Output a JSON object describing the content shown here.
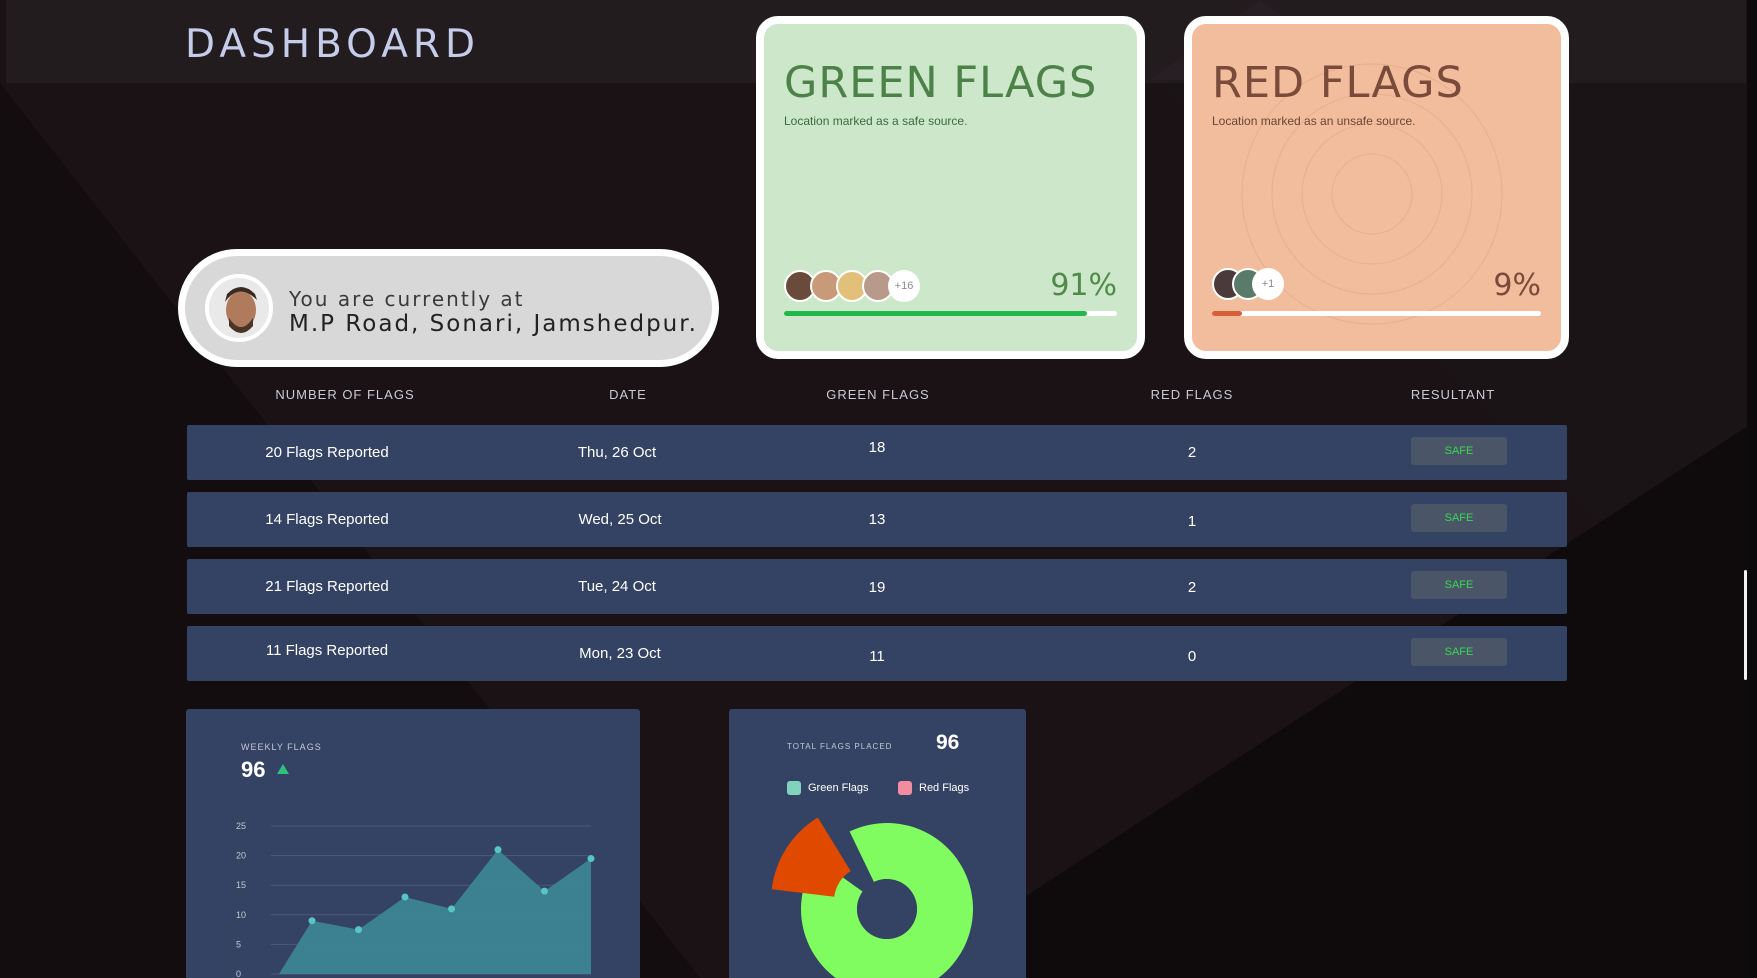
{
  "header": {
    "title": "DASHBOARD"
  },
  "location": {
    "line1": "You are currently at",
    "line2": "M.P Road, Sonari, Jamshedpur."
  },
  "green_card": {
    "title": "GREEN FLAGS",
    "subtitle": "Location marked as a safe source.",
    "percent_label": "91%",
    "percent_value": 0.91,
    "more_label": "+16",
    "color": "#20b84a"
  },
  "red_card": {
    "title": "RED FLAGS",
    "subtitle": "Location marked as an unsafe source.",
    "percent_label": "9%",
    "percent_value": 0.09,
    "more_label": "+1",
    "color": "#d4603a"
  },
  "table": {
    "headers": [
      "NUMBER OF FLAGS",
      "DATE",
      "GREEN FLAGS",
      "RED FLAGS",
      "RESULTANT"
    ],
    "rows": [
      {
        "flags": "20 Flags Reported",
        "date": "Thu, 26 Oct",
        "green": "18",
        "red": "2",
        "result": "SAFE"
      },
      {
        "flags": "14 Flags Reported",
        "date": "Wed, 25 Oct",
        "green": "13",
        "red": "1",
        "result": "SAFE"
      },
      {
        "flags": "21 Flags Reported",
        "date": "Tue, 24 Oct",
        "green": "19",
        "red": "2",
        "result": "SAFE"
      },
      {
        "flags": "11 Flags Reported",
        "date": "Mon, 23 Oct",
        "green": "11",
        "red": "0",
        "result": "SAFE"
      }
    ]
  },
  "weekly": {
    "caption": "WEEKLY FLAGS",
    "total": "96"
  },
  "total_widget": {
    "caption": "TOTAL FLAGS PLACED",
    "total": "96",
    "legend_green": "Green Flags",
    "legend_red": "Red Flags"
  },
  "chart_data": [
    {
      "type": "area",
      "title": "WEEKLY FLAGS",
      "x": [
        1,
        2,
        3,
        4,
        5,
        6,
        7
      ],
      "values": [
        9,
        7.5,
        13,
        11,
        21,
        14,
        19.5
      ],
      "yticks": [
        0,
        5,
        10,
        15,
        20,
        25
      ],
      "ylim": [
        0,
        25
      ],
      "grid": true,
      "color": "#3d8593"
    },
    {
      "type": "pie",
      "title": "TOTAL FLAGS PLACED",
      "categories": [
        "Green Flags",
        "Red Flags"
      ],
      "values": [
        87,
        9
      ],
      "colors": [
        "#80fc60",
        "#e04a00"
      ]
    }
  ]
}
